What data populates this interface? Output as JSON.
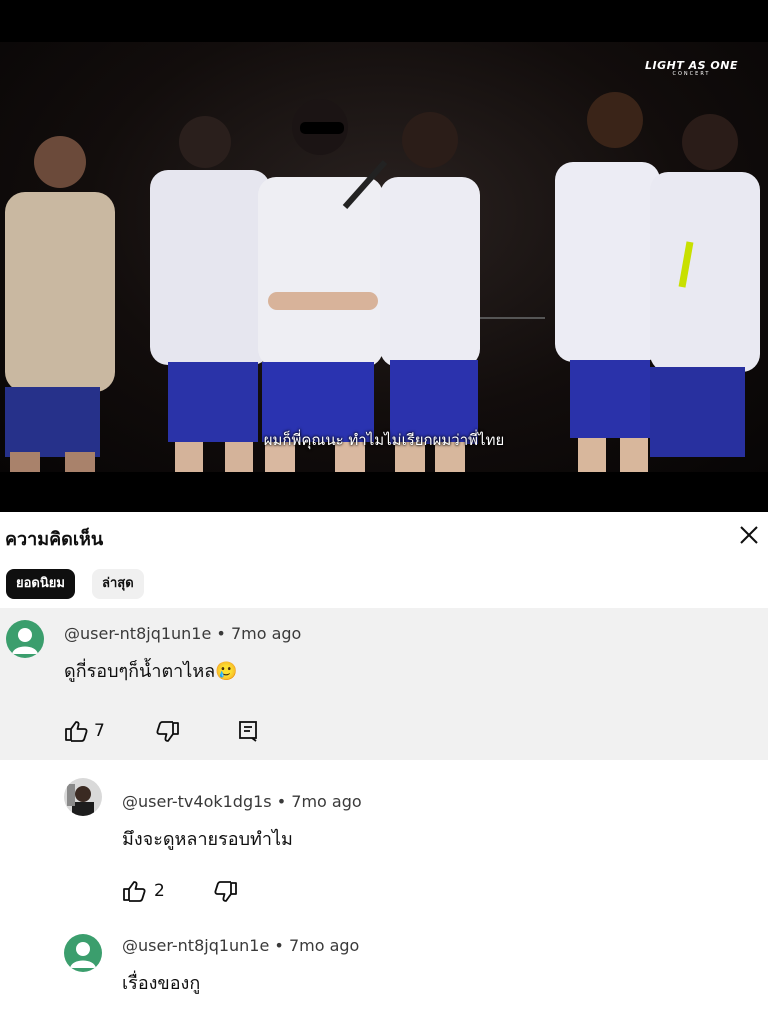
{
  "video": {
    "logo_main": "LIGHT AS ONE",
    "logo_sub": "CONCERT",
    "subtitle": "ผมก็พี่คุณนะ ทำไมไม่เรียกผมว่าพี่ไทย"
  },
  "comments_panel": {
    "title": "ความคิดเห็น",
    "close_icon": "close-icon",
    "sort_tabs": [
      "ยอดนิยม",
      "ล่าสุด"
    ],
    "active_tab": "ยอดนิยม"
  },
  "comments": [
    {
      "handle": "@user-nt8jq1un1e",
      "time": "7mo ago",
      "text": "ดูกี่รอบๆก็น้ำตาไหล",
      "emoji": "🥲",
      "likes": "7",
      "avatar_color": "#3b9e6d",
      "highlighted": true
    },
    {
      "handle": "@user-tv4ok1dg1s",
      "time": "7mo ago",
      "text": "มึงจะดูหลายรอบทำไม",
      "likes": "2",
      "reply": true
    },
    {
      "handle": "@user-nt8jq1un1e",
      "time": "7mo ago",
      "text": "เรื่องของกู",
      "avatar_color": "#3b9e6d",
      "reply": true
    }
  ],
  "colors": {
    "highlight_bg": "#f1f1f1",
    "active_chip": "#0f0f0f",
    "inactive_chip": "#f0f0f0"
  }
}
